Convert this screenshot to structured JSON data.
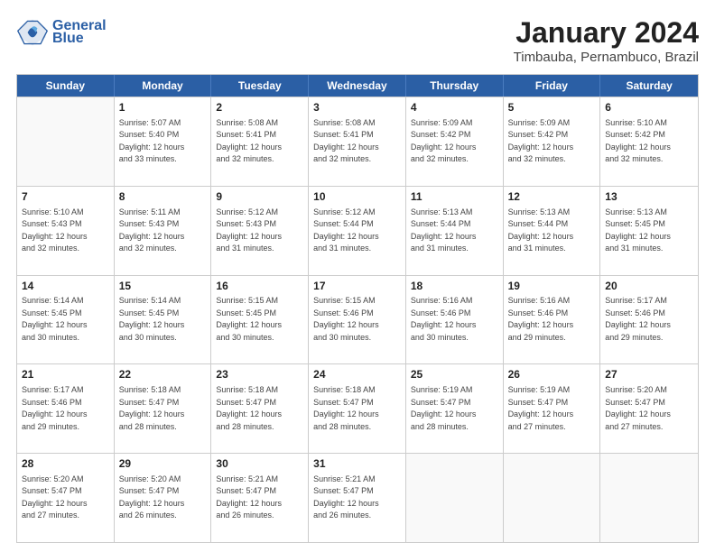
{
  "header": {
    "logo_line1": "General",
    "logo_line2": "Blue",
    "title": "January 2024",
    "subtitle": "Timbauba, Pernambuco, Brazil"
  },
  "weekdays": [
    "Sunday",
    "Monday",
    "Tuesday",
    "Wednesday",
    "Thursday",
    "Friday",
    "Saturday"
  ],
  "rows": [
    [
      {
        "day": "",
        "info": ""
      },
      {
        "day": "1",
        "info": "Sunrise: 5:07 AM\nSunset: 5:40 PM\nDaylight: 12 hours\nand 33 minutes."
      },
      {
        "day": "2",
        "info": "Sunrise: 5:08 AM\nSunset: 5:41 PM\nDaylight: 12 hours\nand 32 minutes."
      },
      {
        "day": "3",
        "info": "Sunrise: 5:08 AM\nSunset: 5:41 PM\nDaylight: 12 hours\nand 32 minutes."
      },
      {
        "day": "4",
        "info": "Sunrise: 5:09 AM\nSunset: 5:42 PM\nDaylight: 12 hours\nand 32 minutes."
      },
      {
        "day": "5",
        "info": "Sunrise: 5:09 AM\nSunset: 5:42 PM\nDaylight: 12 hours\nand 32 minutes."
      },
      {
        "day": "6",
        "info": "Sunrise: 5:10 AM\nSunset: 5:42 PM\nDaylight: 12 hours\nand 32 minutes."
      }
    ],
    [
      {
        "day": "7",
        "info": "Sunrise: 5:10 AM\nSunset: 5:43 PM\nDaylight: 12 hours\nand 32 minutes."
      },
      {
        "day": "8",
        "info": "Sunrise: 5:11 AM\nSunset: 5:43 PM\nDaylight: 12 hours\nand 32 minutes."
      },
      {
        "day": "9",
        "info": "Sunrise: 5:12 AM\nSunset: 5:43 PM\nDaylight: 12 hours\nand 31 minutes."
      },
      {
        "day": "10",
        "info": "Sunrise: 5:12 AM\nSunset: 5:44 PM\nDaylight: 12 hours\nand 31 minutes."
      },
      {
        "day": "11",
        "info": "Sunrise: 5:13 AM\nSunset: 5:44 PM\nDaylight: 12 hours\nand 31 minutes."
      },
      {
        "day": "12",
        "info": "Sunrise: 5:13 AM\nSunset: 5:44 PM\nDaylight: 12 hours\nand 31 minutes."
      },
      {
        "day": "13",
        "info": "Sunrise: 5:13 AM\nSunset: 5:45 PM\nDaylight: 12 hours\nand 31 minutes."
      }
    ],
    [
      {
        "day": "14",
        "info": "Sunrise: 5:14 AM\nSunset: 5:45 PM\nDaylight: 12 hours\nand 30 minutes."
      },
      {
        "day": "15",
        "info": "Sunrise: 5:14 AM\nSunset: 5:45 PM\nDaylight: 12 hours\nand 30 minutes."
      },
      {
        "day": "16",
        "info": "Sunrise: 5:15 AM\nSunset: 5:45 PM\nDaylight: 12 hours\nand 30 minutes."
      },
      {
        "day": "17",
        "info": "Sunrise: 5:15 AM\nSunset: 5:46 PM\nDaylight: 12 hours\nand 30 minutes."
      },
      {
        "day": "18",
        "info": "Sunrise: 5:16 AM\nSunset: 5:46 PM\nDaylight: 12 hours\nand 30 minutes."
      },
      {
        "day": "19",
        "info": "Sunrise: 5:16 AM\nSunset: 5:46 PM\nDaylight: 12 hours\nand 29 minutes."
      },
      {
        "day": "20",
        "info": "Sunrise: 5:17 AM\nSunset: 5:46 PM\nDaylight: 12 hours\nand 29 minutes."
      }
    ],
    [
      {
        "day": "21",
        "info": "Sunrise: 5:17 AM\nSunset: 5:46 PM\nDaylight: 12 hours\nand 29 minutes."
      },
      {
        "day": "22",
        "info": "Sunrise: 5:18 AM\nSunset: 5:47 PM\nDaylight: 12 hours\nand 28 minutes."
      },
      {
        "day": "23",
        "info": "Sunrise: 5:18 AM\nSunset: 5:47 PM\nDaylight: 12 hours\nand 28 minutes."
      },
      {
        "day": "24",
        "info": "Sunrise: 5:18 AM\nSunset: 5:47 PM\nDaylight: 12 hours\nand 28 minutes."
      },
      {
        "day": "25",
        "info": "Sunrise: 5:19 AM\nSunset: 5:47 PM\nDaylight: 12 hours\nand 28 minutes."
      },
      {
        "day": "26",
        "info": "Sunrise: 5:19 AM\nSunset: 5:47 PM\nDaylight: 12 hours\nand 27 minutes."
      },
      {
        "day": "27",
        "info": "Sunrise: 5:20 AM\nSunset: 5:47 PM\nDaylight: 12 hours\nand 27 minutes."
      }
    ],
    [
      {
        "day": "28",
        "info": "Sunrise: 5:20 AM\nSunset: 5:47 PM\nDaylight: 12 hours\nand 27 minutes."
      },
      {
        "day": "29",
        "info": "Sunrise: 5:20 AM\nSunset: 5:47 PM\nDaylight: 12 hours\nand 26 minutes."
      },
      {
        "day": "30",
        "info": "Sunrise: 5:21 AM\nSunset: 5:47 PM\nDaylight: 12 hours\nand 26 minutes."
      },
      {
        "day": "31",
        "info": "Sunrise: 5:21 AM\nSunset: 5:47 PM\nDaylight: 12 hours\nand 26 minutes."
      },
      {
        "day": "",
        "info": ""
      },
      {
        "day": "",
        "info": ""
      },
      {
        "day": "",
        "info": ""
      }
    ]
  ]
}
